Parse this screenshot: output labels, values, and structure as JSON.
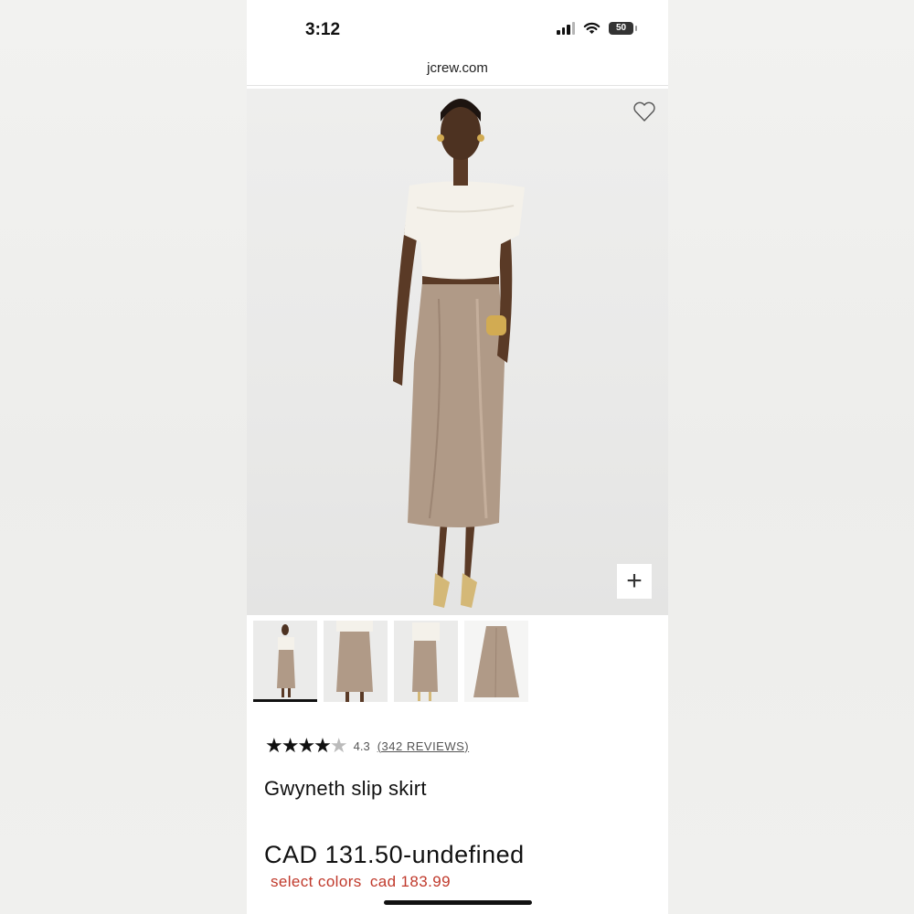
{
  "status_bar": {
    "time": "3:12",
    "battery": "50",
    "icons": [
      "signal-icon",
      "wifi-icon",
      "battery-icon"
    ]
  },
  "browser": {
    "url": "jcrew.com"
  },
  "hero": {
    "wishlist_icon": "heart-outline-icon",
    "zoom_icon": "plus-icon"
  },
  "thumbnails": [
    {
      "name": "front-full-view",
      "active": true
    },
    {
      "name": "skirt-front-view",
      "active": false
    },
    {
      "name": "skirt-side-view",
      "active": false
    },
    {
      "name": "skirt-flat-view",
      "active": false
    }
  ],
  "rating": {
    "stars": "★★★★★",
    "value": "4.3",
    "reviews_label": "(342 REVIEWS)",
    "score": 4.3
  },
  "product": {
    "name": "Gwyneth slip skirt",
    "price": "CAD 131.50-undefined",
    "sale_label": "select colors",
    "sale_price": "cad 183.99"
  },
  "colors": {
    "sale_text": "#c0392b",
    "skirt": "#b09a87",
    "top": "#f4f1ea"
  }
}
